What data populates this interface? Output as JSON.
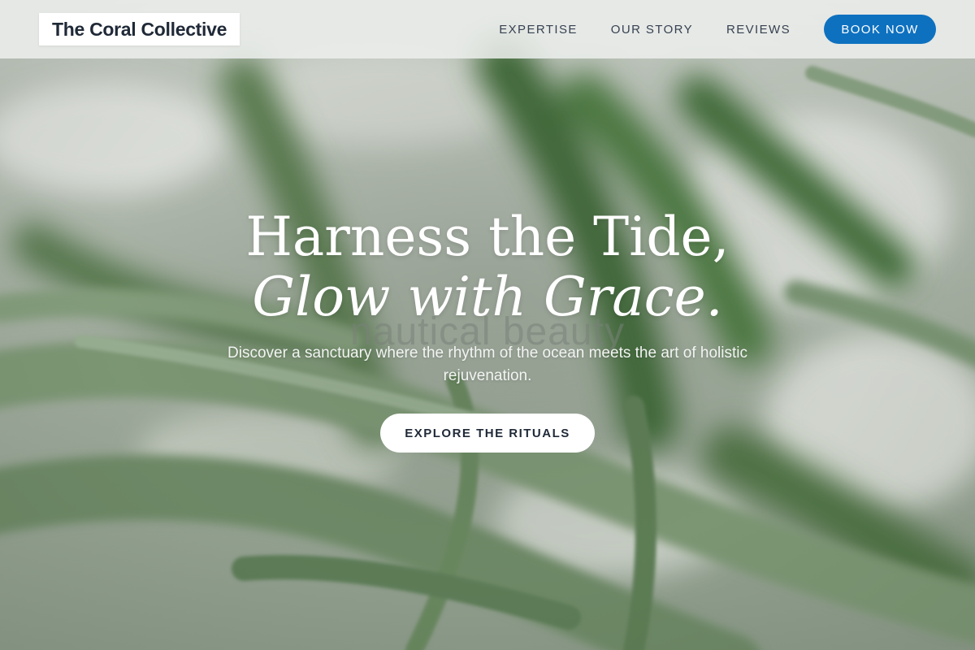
{
  "brand": {
    "name": "The Coral Collective"
  },
  "nav": {
    "links": [
      "EXPERTISE",
      "OUR STORY",
      "REVIEWS"
    ],
    "book_label": "BOOK NOW"
  },
  "hero": {
    "headline_line1": "Harness the Tide,",
    "headline_line2": "Glow with Grace.",
    "watermark": "nautical beauty",
    "subtext": "Discover a sanctuary where the rhythm of the ocean meets the art of holistic rejuvenation.",
    "cta_label": "EXPLORE THE RITUALS"
  },
  "colors": {
    "accent": "#0e71c0",
    "text_dark": "#1f2937",
    "nav_bg": "#eceeec"
  }
}
